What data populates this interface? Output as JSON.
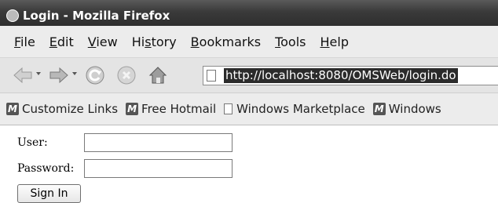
{
  "window": {
    "title": "Login - Mozilla Firefox"
  },
  "menubar": {
    "items": [
      {
        "label_underlined": "F",
        "label_rest": "ile"
      },
      {
        "label_underlined": "E",
        "label_rest": "dit"
      },
      {
        "label_underlined": "V",
        "label_rest": "iew"
      },
      {
        "label_pre": "Hi",
        "label_underlined": "s",
        "label_rest": "tory"
      },
      {
        "label_underlined": "B",
        "label_rest": "ookmarks"
      },
      {
        "label_underlined": "T",
        "label_rest": "ools"
      },
      {
        "label_underlined": "H",
        "label_rest": "elp"
      }
    ]
  },
  "navbar": {
    "icons": [
      "back-arrow-icon",
      "forward-arrow-icon",
      "reload-icon",
      "stop-icon",
      "home-icon"
    ],
    "url": "http://localhost:8080/OMSWeb/login.do"
  },
  "bookmarks": {
    "items": [
      {
        "label": "Customize Links",
        "icon": "m-icon"
      },
      {
        "label": "Free Hotmail",
        "icon": "m-icon"
      },
      {
        "label": "Windows Marketplace",
        "icon": "page-icon"
      },
      {
        "label": "Windows",
        "icon": "m-icon"
      }
    ]
  },
  "form": {
    "user_label": "User:",
    "user_value": "",
    "password_label": "Password:",
    "password_value": "",
    "signin_label": "Sign In"
  }
}
